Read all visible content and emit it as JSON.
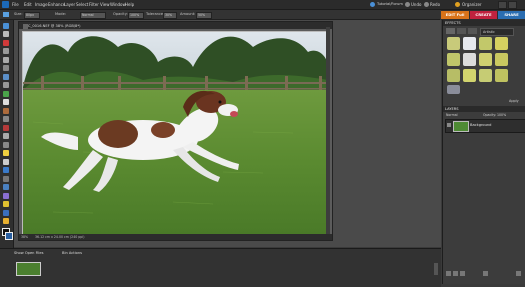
{
  "menubar": {
    "items": [
      "File",
      "Edit",
      "Image",
      "Enhance",
      "Layer",
      "Select",
      "Filter",
      "View",
      "Window",
      "Help"
    ],
    "tutorial": "Tutorial/Forum",
    "undo": "Undo",
    "redo": "Redo",
    "organizer": "Organizer"
  },
  "options": {
    "size_label": "Size:",
    "size_value": "80px",
    "mode_label": "Mode:",
    "mode_value": "Normal",
    "patterned": "Pattern",
    "opacity_label": "Opacity:",
    "opacity_value": "100%",
    "tolerance_label": "Tolerance:",
    "tolerance_value": "30%",
    "brush_label": "Brush:",
    "amount_label": "Amount:",
    "amount_value": "50%"
  },
  "tabs": {
    "edit": "EDIT Full",
    "create": "CREATE",
    "share": "SHARE"
  },
  "document": {
    "title": "DSC_0016.NEF @ 38% (RGB/8*)",
    "zoom": "38%",
    "dims": "36.12 cm x 24.00 cm (240 ppi)"
  },
  "panels": {
    "effects_title": "EFFECTS",
    "filter_dropdown": "Artistic",
    "apply_label": "Apply",
    "layers_title": "LAYERS",
    "blend_mode": "Normal",
    "opacity_label": "Opacity:",
    "opacity_value": "100%",
    "layer_name": "Background"
  },
  "bin": {
    "show_open_files": "Show Open Files",
    "bin_actions": "Bin Actions"
  }
}
